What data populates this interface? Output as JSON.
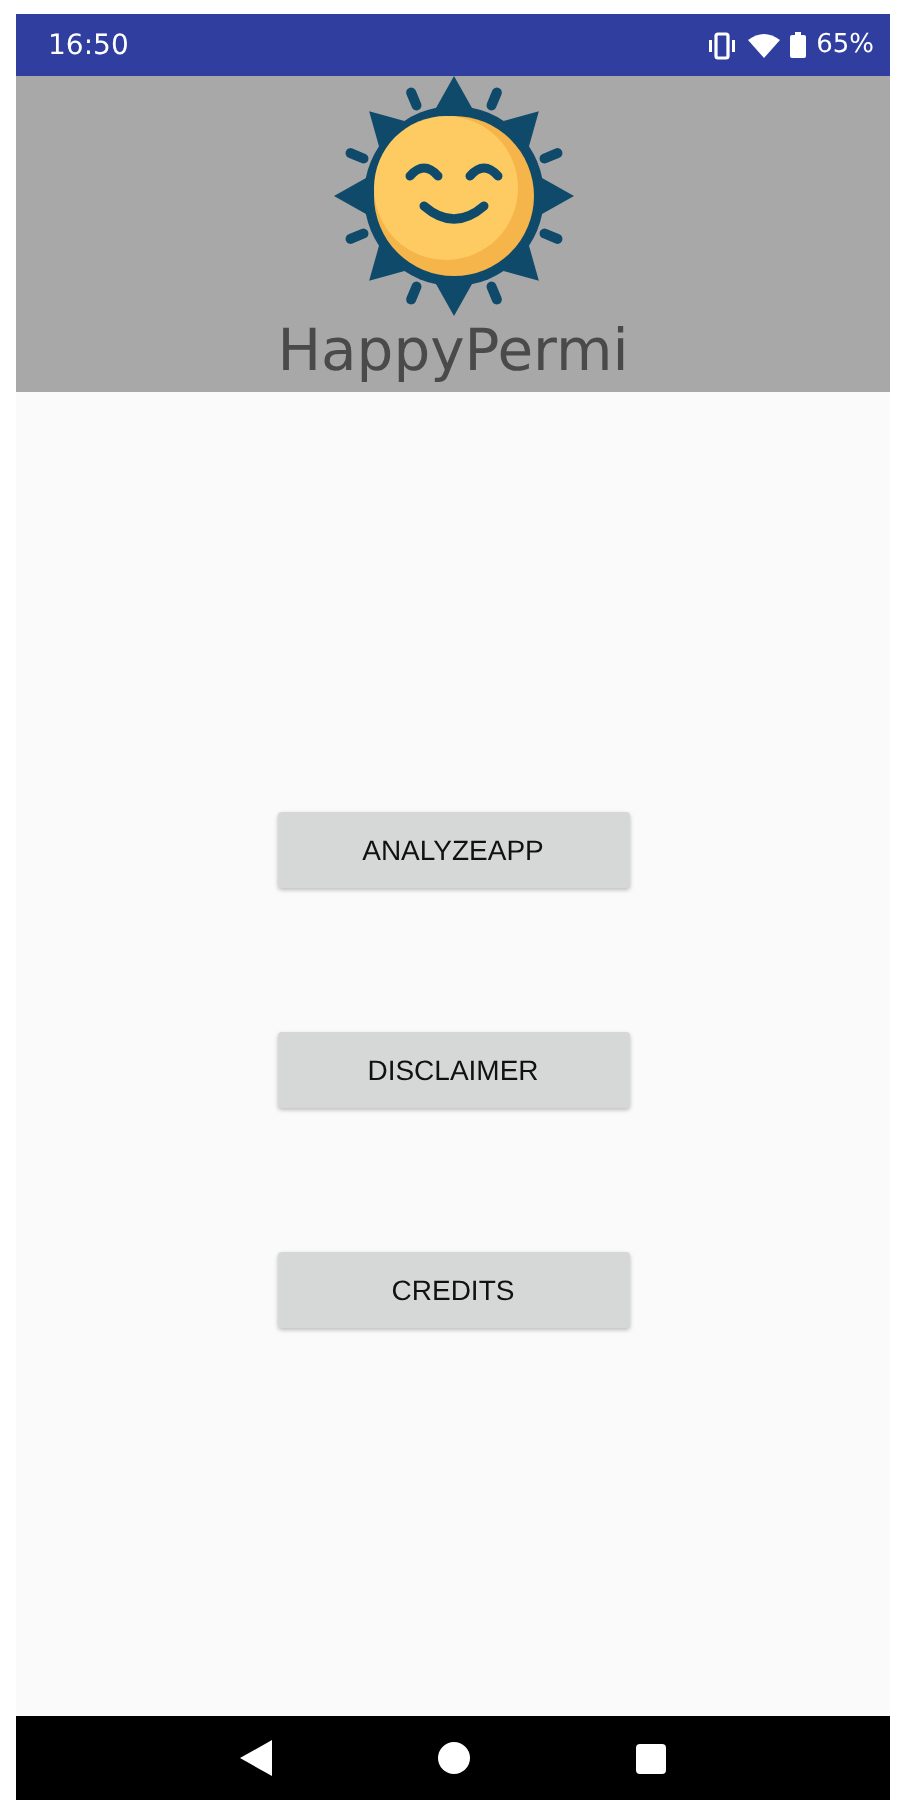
{
  "status_bar": {
    "time": "16:50",
    "battery": "65%"
  },
  "header": {
    "title": "HappyPermi"
  },
  "buttons": [
    "ANALYZEAPP",
    "DISCLAIMER",
    "CREDITS"
  ]
}
